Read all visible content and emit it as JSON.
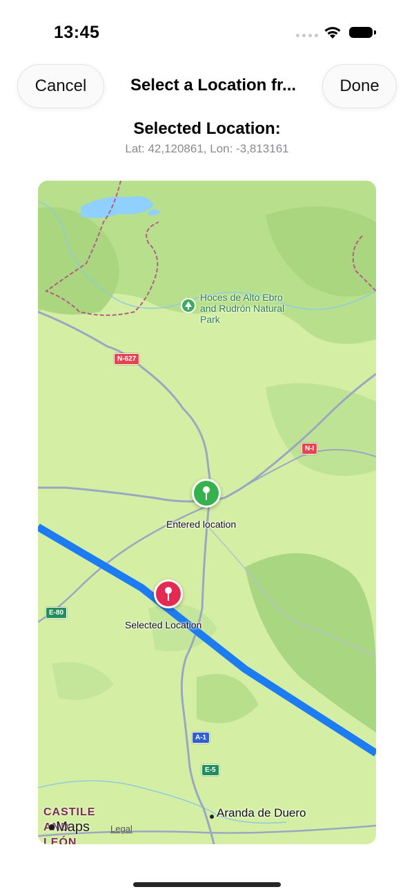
{
  "status": {
    "time": "13:45"
  },
  "nav": {
    "cancel_label": "Cancel",
    "title": "Select a Location fr...",
    "done_label": "Done"
  },
  "selection": {
    "heading": "Selected Location:",
    "coordinates": "Lat: 42,120861, Lon: -3,813161"
  },
  "map": {
    "park_label": "Hoces de Alto Ebro and Rudrón Natural Park",
    "road_badges": [
      "N-627",
      "N-I",
      "E-80",
      "A-1",
      "E-5"
    ],
    "entered_pin_label": "Entered location",
    "selected_pin_label": "Selected Location",
    "city_label": "Aranda de Duero",
    "region_label": "CASTILE AND LEÓN",
    "attribution": "Maps",
    "legal_label": "Legal",
    "colors": {
      "route": "#1e7cf2",
      "entered_pin": "#35b24b",
      "selected_pin": "#e42a52"
    }
  }
}
